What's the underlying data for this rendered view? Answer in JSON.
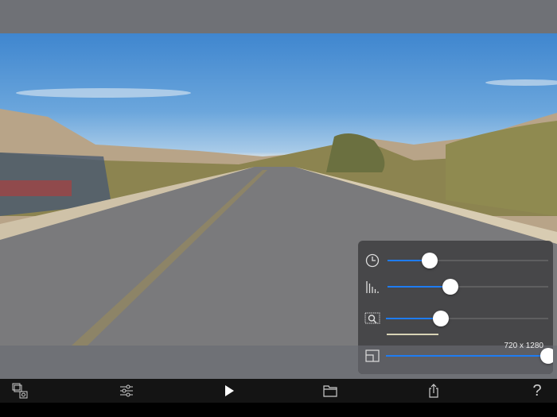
{
  "toolbar": {
    "items": [
      {
        "icon": "photo-video-library-icon"
      },
      {
        "icon": "sliders-icon"
      },
      {
        "icon": "play-icon"
      },
      {
        "icon": "folder-icon"
      },
      {
        "icon": "share-icon"
      },
      {
        "icon": "help-icon",
        "label": "?"
      }
    ]
  },
  "panel": {
    "sliders": [
      {
        "icon": "clock-icon",
        "value_percent": 26
      },
      {
        "icon": "bar-levels-icon",
        "value_percent": 39
      },
      {
        "icon": "film-zoom-icon",
        "value_percent": 34,
        "progress_percent": 32
      },
      {
        "icon": "resolution-icon",
        "value_percent": 100
      }
    ],
    "resolution_label": "720 x 1280"
  },
  "colors": {
    "accent": "#1e7cf2"
  }
}
